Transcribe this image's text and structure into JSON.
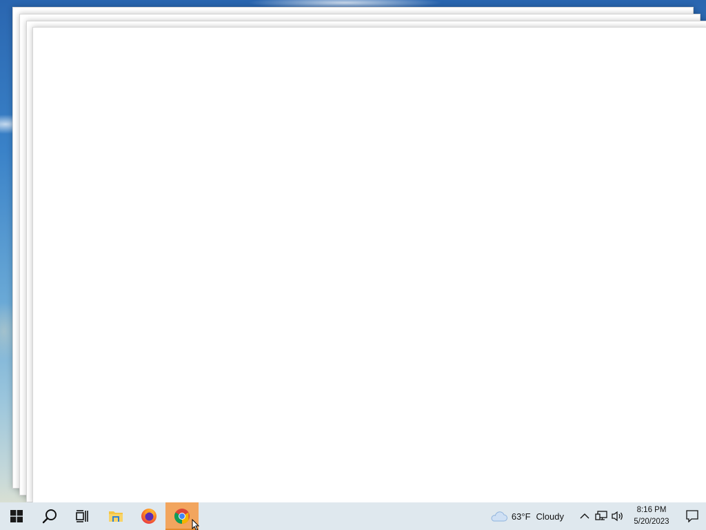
{
  "taskbar": {
    "start_icon": "windows-logo-icon",
    "search_icon": "search-icon",
    "task_view_icon": "task-view-icon",
    "pinned": [
      {
        "name": "file-explorer",
        "icon": "folder-icon"
      },
      {
        "name": "firefox",
        "icon": "firefox-icon"
      },
      {
        "name": "chrome",
        "icon": "chrome-icon",
        "active": true
      }
    ]
  },
  "tray": {
    "weather": {
      "icon": "cloud-icon",
      "temperature": "63°F",
      "condition": "Cloudy"
    },
    "overflow_icon": "chevron-up-icon",
    "network_icon": "network-icon",
    "volume_icon": "speaker-icon",
    "time": "8:16 PM",
    "date": "5/20/2023",
    "notification_icon": "notification-icon"
  },
  "colors": {
    "taskbar_bg": "#dfe8ee",
    "active_app_highlight": "#f2a55e"
  }
}
